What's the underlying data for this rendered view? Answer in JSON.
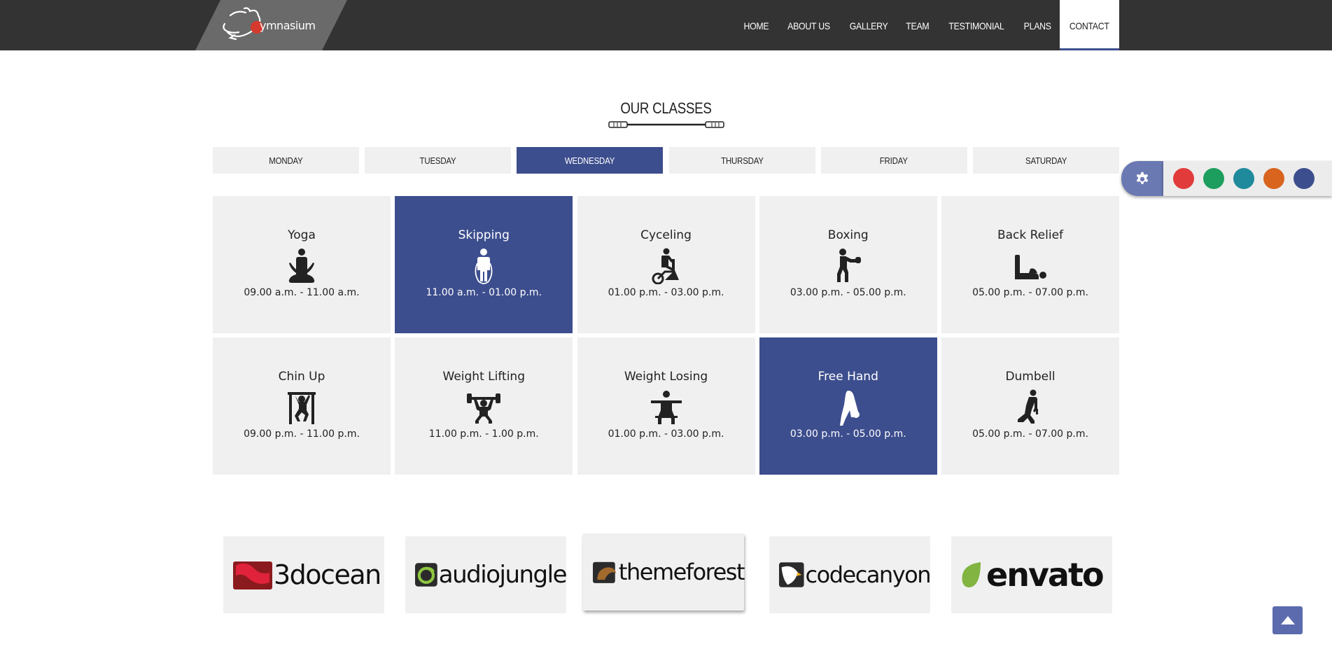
{
  "header": {
    "logo_text": "ymnasium",
    "nav": [
      "HOME",
      "ABOUT US",
      "GALLERY",
      "TEAM",
      "TESTIMONIAL",
      "PLANS",
      "CONTACT"
    ],
    "active_nav": "CONTACT"
  },
  "classes_section": {
    "title": "OUR CLASSES",
    "days": [
      "MONDAY",
      "TUESDAY",
      "WEDNESDAY",
      "THURSDAY",
      "FRIDAY",
      "SATURDAY"
    ],
    "active_day": "WEDNESDAY",
    "classes": [
      {
        "name": "Yoga",
        "time": "09.00 a.m. - 11.00 a.m.",
        "icon": "yoga-icon",
        "active": false
      },
      {
        "name": "Skipping",
        "time": "11.00 a.m. - 01.00 p.m.",
        "icon": "skipping-icon",
        "active": true
      },
      {
        "name": "Cyceling",
        "time": "01.00 p.m. - 03.00 p.m.",
        "icon": "cycling-icon",
        "active": false
      },
      {
        "name": "Boxing",
        "time": "03.00 p.m. - 05.00 p.m.",
        "icon": "boxing-icon",
        "active": false
      },
      {
        "name": "Back Relief",
        "time": "05.00 p.m. - 07.00 p.m.",
        "icon": "back-relief-icon",
        "active": false
      },
      {
        "name": "Chin Up",
        "time": "09.00 p.m. - 11.00 p.m.",
        "icon": "chin-up-icon",
        "active": false
      },
      {
        "name": "Weight Lifting",
        "time": "11.00 p.m. - 1.00 p.m.",
        "icon": "weight-lifting-icon",
        "active": false
      },
      {
        "name": "Weight Losing",
        "time": "01.00 p.m. - 03.00 p.m.",
        "icon": "weight-losing-icon",
        "active": false
      },
      {
        "name": "Free Hand",
        "time": "03.00 p.m. - 05.00 p.m.",
        "icon": "free-hand-icon",
        "active": true
      },
      {
        "name": "Dumbell",
        "time": "05.00 p.m. - 07.00 p.m.",
        "icon": "dumbbell-icon",
        "active": false
      }
    ]
  },
  "color_switcher": {
    "icon": "gear-icon",
    "colors": [
      "#e23b3b",
      "#1e9e5e",
      "#1f8a9c",
      "#d8641e",
      "#3d4e8e"
    ]
  },
  "brands": [
    "3docean",
    "audiojungle",
    "themeforest",
    "codecanyon",
    "envato"
  ],
  "colors": {
    "header_bg": "#333333",
    "accent": "#3d4e8e",
    "card_bg": "#f0f0f0"
  },
  "back_to_top_icon": "arrow-up-icon"
}
